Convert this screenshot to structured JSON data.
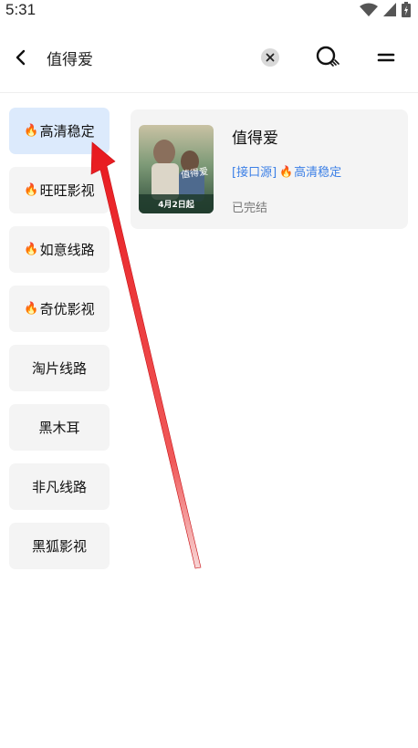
{
  "status_bar": {
    "time": "5:31"
  },
  "toolbar": {
    "query": "值得爱"
  },
  "sources": [
    {
      "label": "高清稳定",
      "hot": true,
      "active": true
    },
    {
      "label": "旺旺影视",
      "hot": true,
      "active": false
    },
    {
      "label": "如意线路",
      "hot": true,
      "active": false
    },
    {
      "label": "奇优影视",
      "hot": true,
      "active": false
    },
    {
      "label": "淘片线路",
      "hot": false,
      "active": false
    },
    {
      "label": "黑木耳",
      "hot": false,
      "active": false
    },
    {
      "label": "非凡线路",
      "hot": false,
      "active": false
    },
    {
      "label": "黑狐影视",
      "hot": false,
      "active": false
    }
  ],
  "result": {
    "title": "值得爱",
    "source_tag": "[接口源]",
    "source_name": "高清稳定",
    "status": "已完结",
    "poster_caption": "4月2日起",
    "poster_title": "值得爱"
  },
  "colors": {
    "accent": "#3b7fe6",
    "active_bg": "#dceafc",
    "arrow": "#e8191e"
  }
}
